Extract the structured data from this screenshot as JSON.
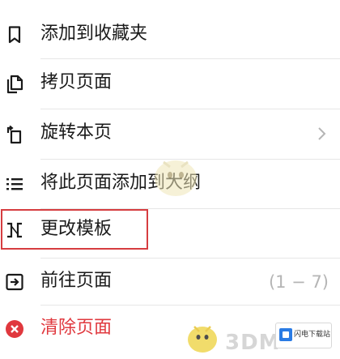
{
  "menu": {
    "items": [
      {
        "label": "添加到收藏夹",
        "icon": "bookmark-icon"
      },
      {
        "label": "拷贝页面",
        "icon": "copy-page-icon"
      },
      {
        "label": "旋转本页",
        "icon": "rotate-page-icon"
      },
      {
        "label": "将此页面添加到大纲",
        "icon": "outline-list-icon"
      },
      {
        "label": "更改模板",
        "icon": "change-template-icon"
      },
      {
        "label": "前往页面",
        "icon": "go-to-page-icon",
        "range": "(1 − 7)"
      },
      {
        "label": "清除页面",
        "icon": "clear-page-icon"
      }
    ]
  },
  "watermark": {
    "text": "3DM",
    "badge": "闪电下载站"
  },
  "colors": {
    "danger": "#e0383e",
    "highlight": "#d63d40",
    "muted": "#b5b5b5",
    "divider": "#e6e6e6"
  }
}
